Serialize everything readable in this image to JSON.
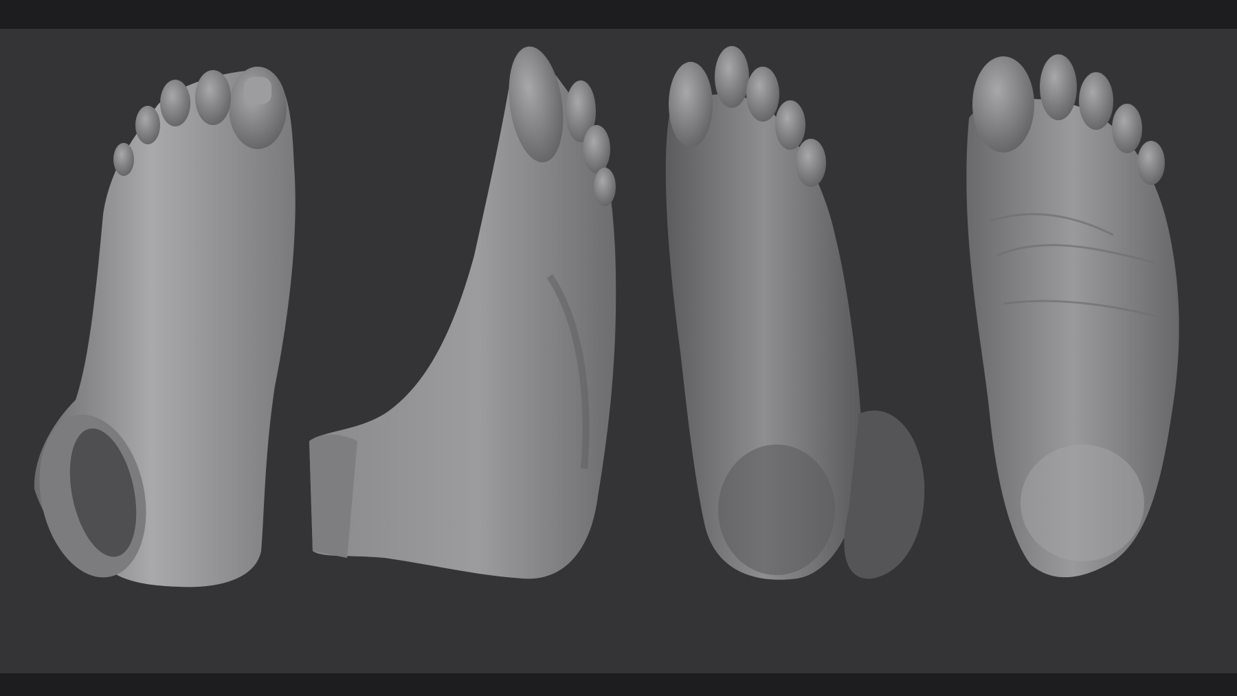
{
  "scene": {
    "kind": "sculpt-turnaround",
    "views": [
      {
        "name": "foot-top-view"
      },
      {
        "name": "foot-side-view"
      },
      {
        "name": "foot-sole-angled-view"
      },
      {
        "name": "foot-sole-view"
      }
    ],
    "colors": {
      "background": "#343436",
      "frame": "#1d1d1f",
      "clay_light": "#a9a9ab",
      "clay_mid": "#858587",
      "clay_dark": "#4b4b4d"
    }
  }
}
